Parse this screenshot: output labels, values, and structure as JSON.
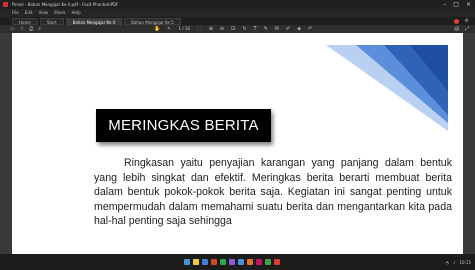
{
  "window": {
    "title": "Pinsel - Bahan Mengajar Ke 4.pdf - Foxit PhantomPDF",
    "controls": [
      "–",
      "□",
      "×"
    ]
  },
  "menubar": {
    "items": [
      "File",
      "Edit",
      "View",
      "Share",
      "Help"
    ]
  },
  "tabs": [
    {
      "label": "Home"
    },
    {
      "label": "Start"
    },
    {
      "label": "Bahan Mengajar Ke 4",
      "active": true
    },
    {
      "label": "Bahan Mengajar Ke 5"
    }
  ],
  "toolbar": {
    "zoom_text": "1 / 16"
  },
  "document": {
    "title": "MERINGKAS BERITA",
    "paragraph": "Ringkasan yaitu penyajian karangan yang panjang dalam bentuk yang lebih singkat dan efektif. Meringkas berita berarti membuat berita dalam bentuk pokok-pokok berita saja. Kegiatan ini sangat penting untuk mempermudah dalam memahami suatu berita dan mengantarkan kita pada hal-hal penting saja sehingga"
  },
  "colors": {
    "shape_dark": "#2f63b8",
    "shape_mid": "#5b8fdc",
    "shape_light": "#b9d0f2",
    "title_bg": "#000000"
  },
  "taskbar": {
    "icon_colors": [
      "#4a90d9",
      "#f2c744",
      "#3f7fd8",
      "#d34a2b",
      "#2ba84a",
      "#8a5cd6",
      "#4a90d9",
      "#e0742a",
      "#c2185b",
      "#43a047",
      "#e53935"
    ],
    "time": "10:15"
  }
}
